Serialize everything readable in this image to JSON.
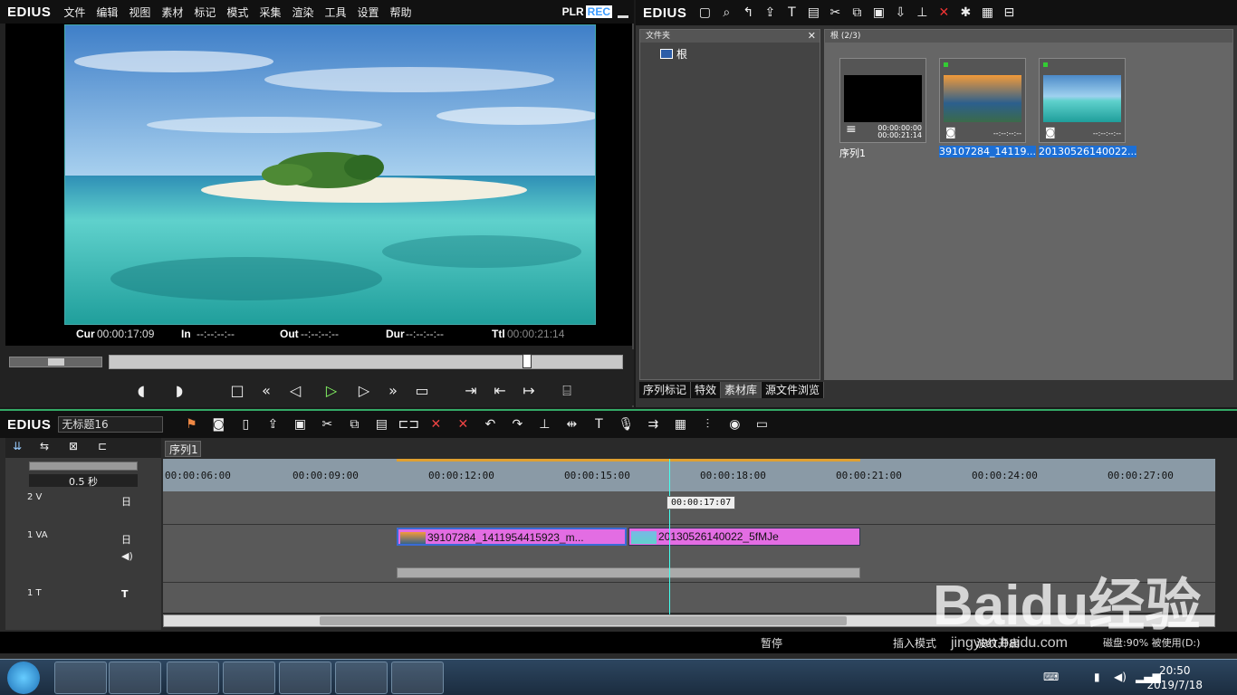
{
  "app": {
    "name": "EDIUS"
  },
  "menu": [
    "文件",
    "编辑",
    "视图",
    "素材",
    "标记",
    "模式",
    "采集",
    "渲染",
    "工具",
    "设置",
    "帮助"
  ],
  "player": {
    "plr": "PLR",
    "rec": "REC",
    "cur_label": "Cur",
    "cur": "00:00:17:09",
    "in_label": "In",
    "in": "--:--:--:--",
    "out_label": "Out",
    "out": "--:--:--:--",
    "dur_label": "Dur",
    "dur": "--:--:--:--",
    "ttl_label": "Ttl",
    "ttl": "00:00:21:14",
    "playback_position_fraction": 0.82
  },
  "bin": {
    "logo": "EDIUS",
    "folder_head": "文件夹",
    "root_folder": "根",
    "clips_head": "根 (2/3)",
    "clips": [
      {
        "caption": "序列1",
        "tc_a": "00:00:00:00",
        "tc_b": "00:00:21:14",
        "selected": false
      },
      {
        "caption": "39107284_14119...",
        "tc_a": "",
        "tc_b": "--:--:--:--",
        "selected": true
      },
      {
        "caption": "20130526140022...",
        "tc_a": "",
        "tc_b": "--:--:--:--",
        "selected": true
      }
    ],
    "tabs": [
      "序列标记",
      "特效",
      "素材库",
      "源文件浏览"
    ]
  },
  "timeline": {
    "logo": "EDIUS",
    "project": "无标题16",
    "seq_tab": "序列1",
    "zoom": "0.5 秒",
    "ruler": [
      "00:00:06:00",
      "00:00:09:00",
      "00:00:12:00",
      "00:00:15:00",
      "00:00:18:00",
      "00:00:21:00",
      "00:00:24:00",
      "00:00:27:00"
    ],
    "tracks": [
      "2 V",
      "1 VA",
      "1 T"
    ],
    "clips": [
      {
        "name": "39107284_1411954415923_m..."
      },
      {
        "name": "20130526140022_5fMJe"
      }
    ],
    "playhead_tc": "00:00:17:07"
  },
  "status": {
    "pause": "暂停",
    "insert_mode": "插入模式",
    "ripple": "波纹开启",
    "disk": "磁盘:90% 被使用(D:)"
  },
  "taskbar": {
    "time": "20:50",
    "date": "2019/7/18"
  },
  "watermark": {
    "brand": "Baidu经验",
    "url": "jingyan.baidu.com"
  }
}
